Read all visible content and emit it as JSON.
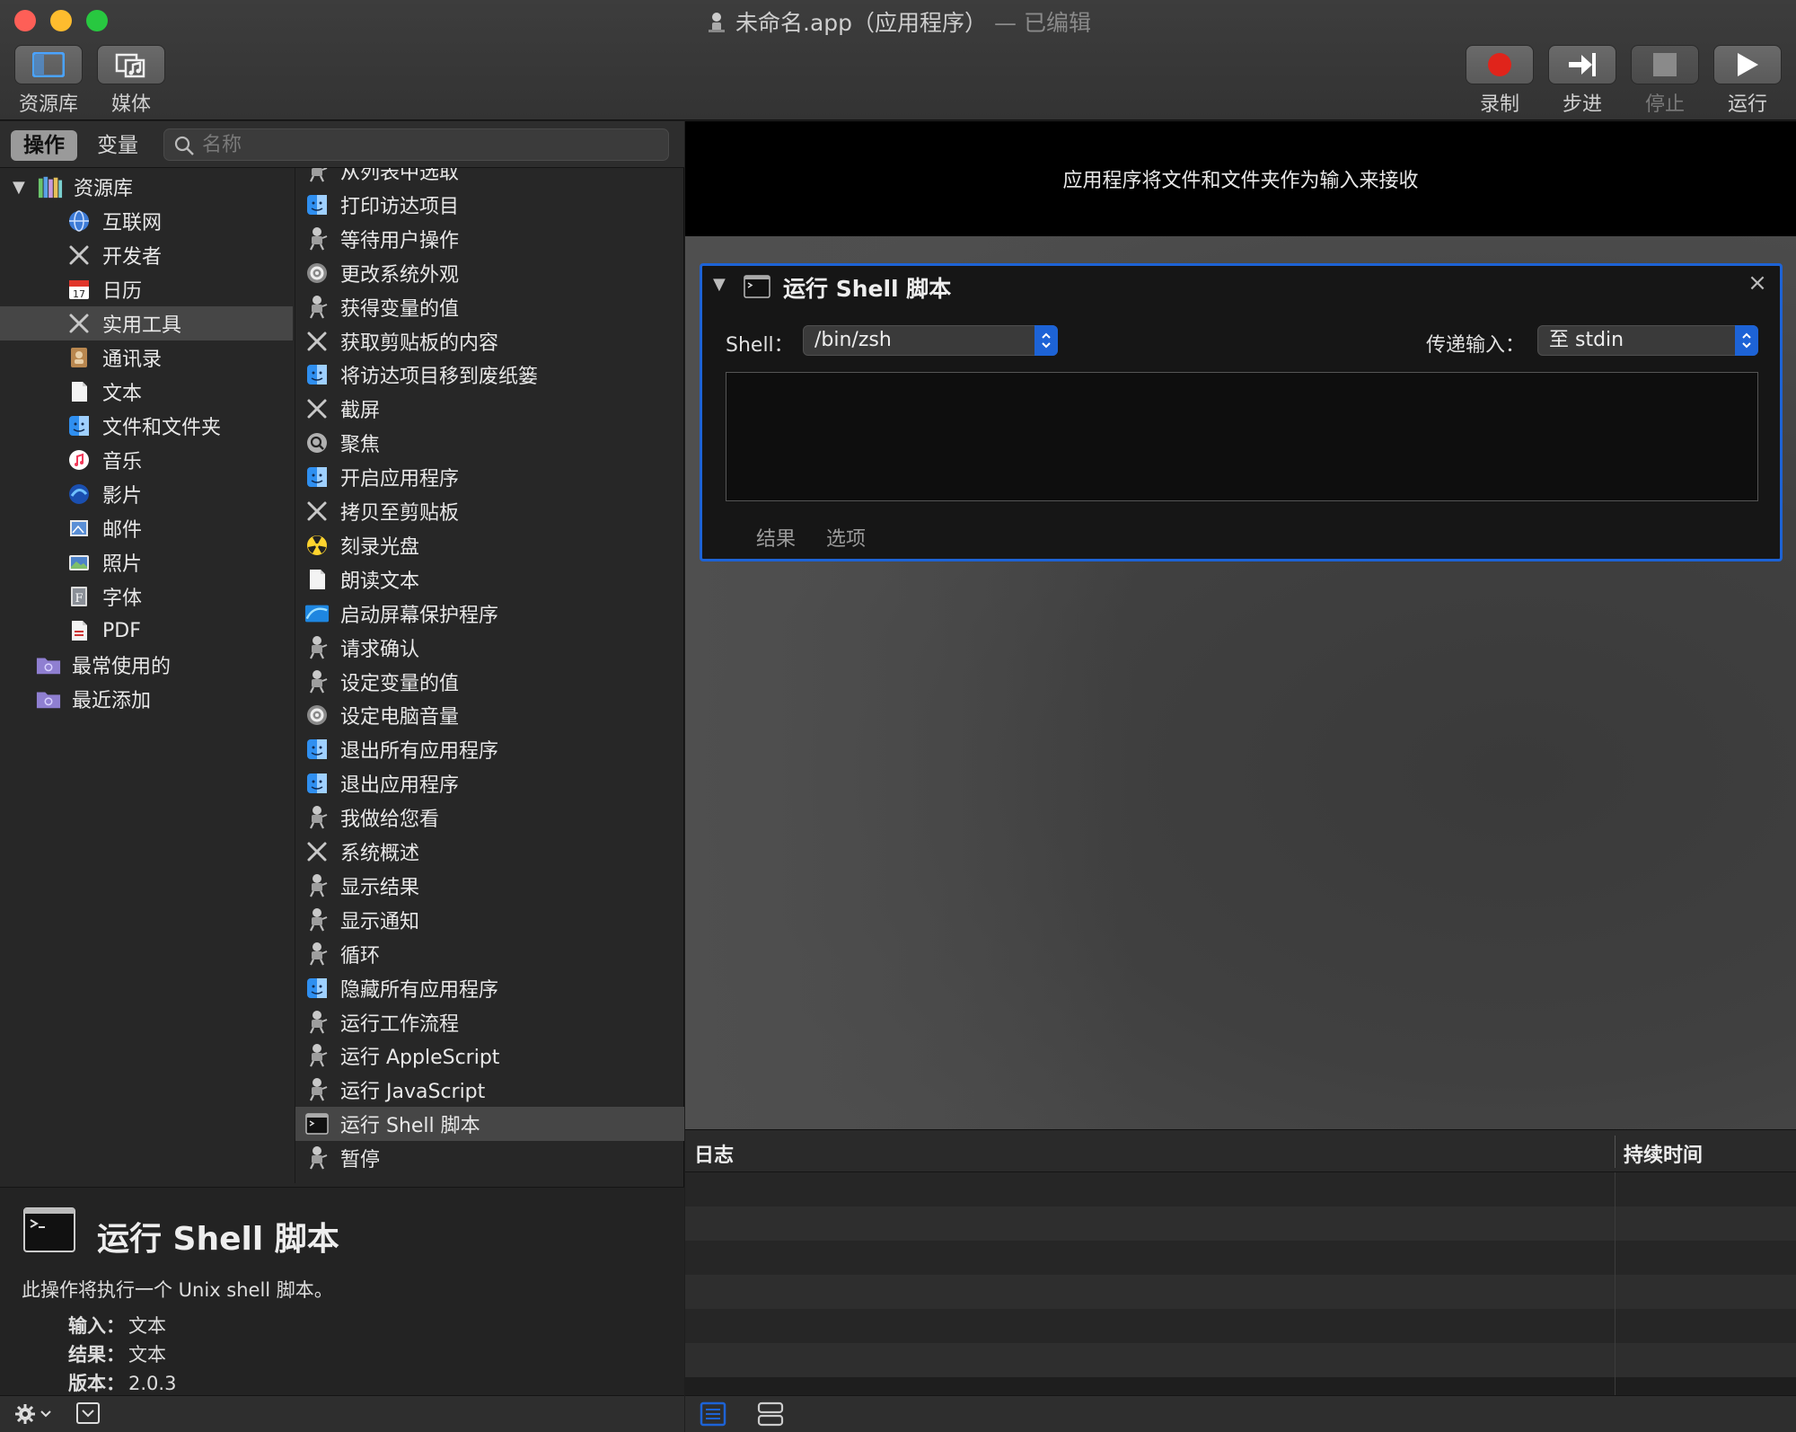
{
  "window": {
    "title": "未命名.app（应用程序）",
    "edited": "— 已编辑"
  },
  "toolbar": {
    "library_label": "资源库",
    "media_label": "媒体",
    "record_label": "录制",
    "step_label": "步进",
    "stop_label": "停止",
    "run_label": "运行"
  },
  "tabs": {
    "actions": "操作",
    "variables": "变量"
  },
  "search": {
    "placeholder": "名称"
  },
  "library": {
    "root": "资源库",
    "items": [
      "互联网",
      "开发者",
      "日历",
      "实用工具",
      "通讯录",
      "文本",
      "文件和文件夹",
      "音乐",
      "影片",
      "邮件",
      "照片",
      "字体",
      "PDF"
    ],
    "selected_index": 3,
    "smart_groups": [
      "最常使用的",
      "最近添加"
    ]
  },
  "actions": {
    "items": [
      "从列表中选取",
      "打印访达项目",
      "等待用户操作",
      "更改系统外观",
      "获得变量的值",
      "获取剪贴板的内容",
      "将访达项目移到废纸篓",
      "截屏",
      "聚焦",
      "开启应用程序",
      "拷贝至剪贴板",
      "刻录光盘",
      "朗读文本",
      "启动屏幕保护程序",
      "请求确认",
      "设定变量的值",
      "设定电脑音量",
      "退出所有应用程序",
      "退出应用程序",
      "我做给您看",
      "系统概述",
      "显示结果",
      "显示通知",
      "循环",
      "隐藏所有应用程序",
      "运行工作流程",
      "运行 AppleScript",
      "运行 JavaScript",
      "运行 Shell 脚本",
      "暂停"
    ],
    "selected_index": 28
  },
  "description": {
    "title": "运行 Shell 脚本",
    "body": "此操作将执行一个 Unix shell 脚本。",
    "input_label": "输入：",
    "input_value": "文本",
    "result_label": "结果：",
    "result_value": "文本",
    "version_label": "版本：",
    "version_value": "2.0.3"
  },
  "workflow": {
    "input_banner": "应用程序将文件和文件夹作为输入来接收",
    "card": {
      "title": "运行 Shell 脚本",
      "shell_label": "Shell：",
      "shell_value": "/bin/zsh",
      "pass_input_label": "传递输入：",
      "pass_input_value": "至 stdin",
      "script": "",
      "tab_results": "结果",
      "tab_options": "选项"
    }
  },
  "log": {
    "col_log": "日志",
    "col_duration": "持续时间"
  },
  "colors": {
    "accent": "#1d63d6",
    "record": "#e0241b"
  }
}
